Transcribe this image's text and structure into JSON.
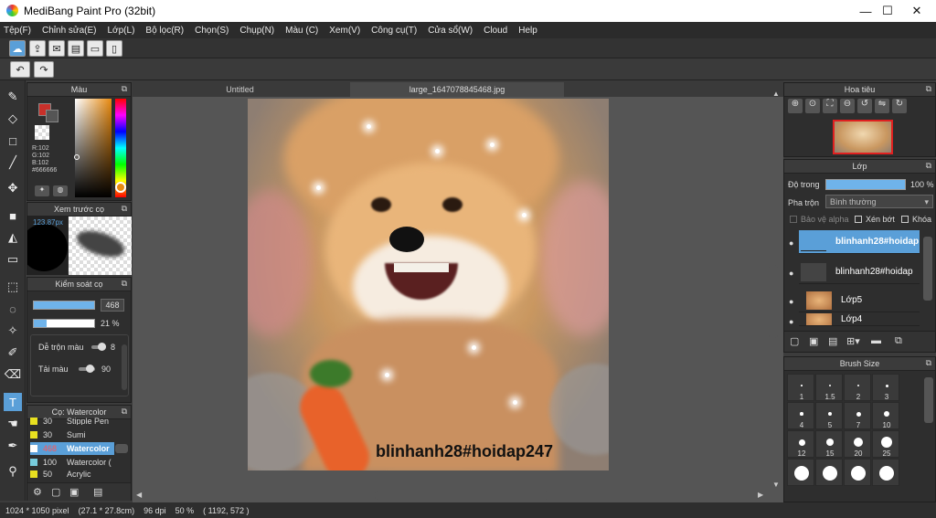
{
  "window": {
    "title": "MediBang Paint Pro (32bit)",
    "minimize": "—",
    "maximize": "☐",
    "close": "✕"
  },
  "menu": [
    "Tệp(F)",
    "Chỉnh sửa(E)",
    "Lớp(L)",
    "Bộ lọc(R)",
    "Chọn(S)",
    "Chụp(N)",
    "Màu (C)",
    "Xem(V)",
    "Công cụ(T)",
    "Cửa sổ(W)",
    "Cloud",
    "Help"
  ],
  "tabs": {
    "tab1": "Untitled",
    "tab2": "large_1647078845468.jpg"
  },
  "color_panel": {
    "title": "Màu",
    "r": "R:102",
    "g": "G:102",
    "b": "B:102",
    "hex": "#666666"
  },
  "brush_preview": {
    "title": "Xem trước cọ",
    "size": "123.87px"
  },
  "brush_control": {
    "title": "Kiểm soát cọ",
    "size_value": "468",
    "opacity_value": "21 %",
    "blend_label": "Dễ trộn màu",
    "blend_value": "8",
    "reload_label": "Tải màu",
    "reload_value": "90"
  },
  "brush_list": {
    "title": "Cọ: Watercolor",
    "items": [
      {
        "num": "30",
        "name": "Stipple Pen"
      },
      {
        "num": "30",
        "name": "Sumi"
      },
      {
        "num": "468",
        "name": "Watercolor"
      },
      {
        "num": "100",
        "name": "Watercolor ("
      },
      {
        "num": "50",
        "name": "Acrylic"
      }
    ]
  },
  "artwork": {
    "watermark": "blinhanh28#hoidap247"
  },
  "navigator": {
    "title": "Hoa tiêu"
  },
  "layer_panel": {
    "title": "Lớp",
    "opacity_label": "Độ trong",
    "opacity_value": "100 %",
    "blend_label": "Pha trộn",
    "blend_value": "Bình thường",
    "protect_alpha": "Bảo vệ alpha",
    "clipping": "Xén bớt",
    "lock": "Khóa",
    "layers": [
      {
        "name": "blinhanh28#hoidap"
      },
      {
        "name": "blinhanh28#hoidap"
      },
      {
        "name": "Lớp5"
      },
      {
        "name": "Lớp4"
      }
    ]
  },
  "brush_size": {
    "title": "Brush Size",
    "labels": [
      "1",
      "1.5",
      "2",
      "3",
      "4",
      "5",
      "7",
      "10",
      "12",
      "15",
      "20",
      "25"
    ]
  },
  "status": {
    "dimensions": "1024 * 1050 pixel",
    "physical": "(27.1 * 27.8cm)",
    "dpi": "96 dpi",
    "zoom": "50 %",
    "coords": "( 1192, 572 )"
  },
  "colors": {
    "accent": "#5a9fd8",
    "fg_color": "#c8302a",
    "selected_layer": "#5a9fd8"
  }
}
